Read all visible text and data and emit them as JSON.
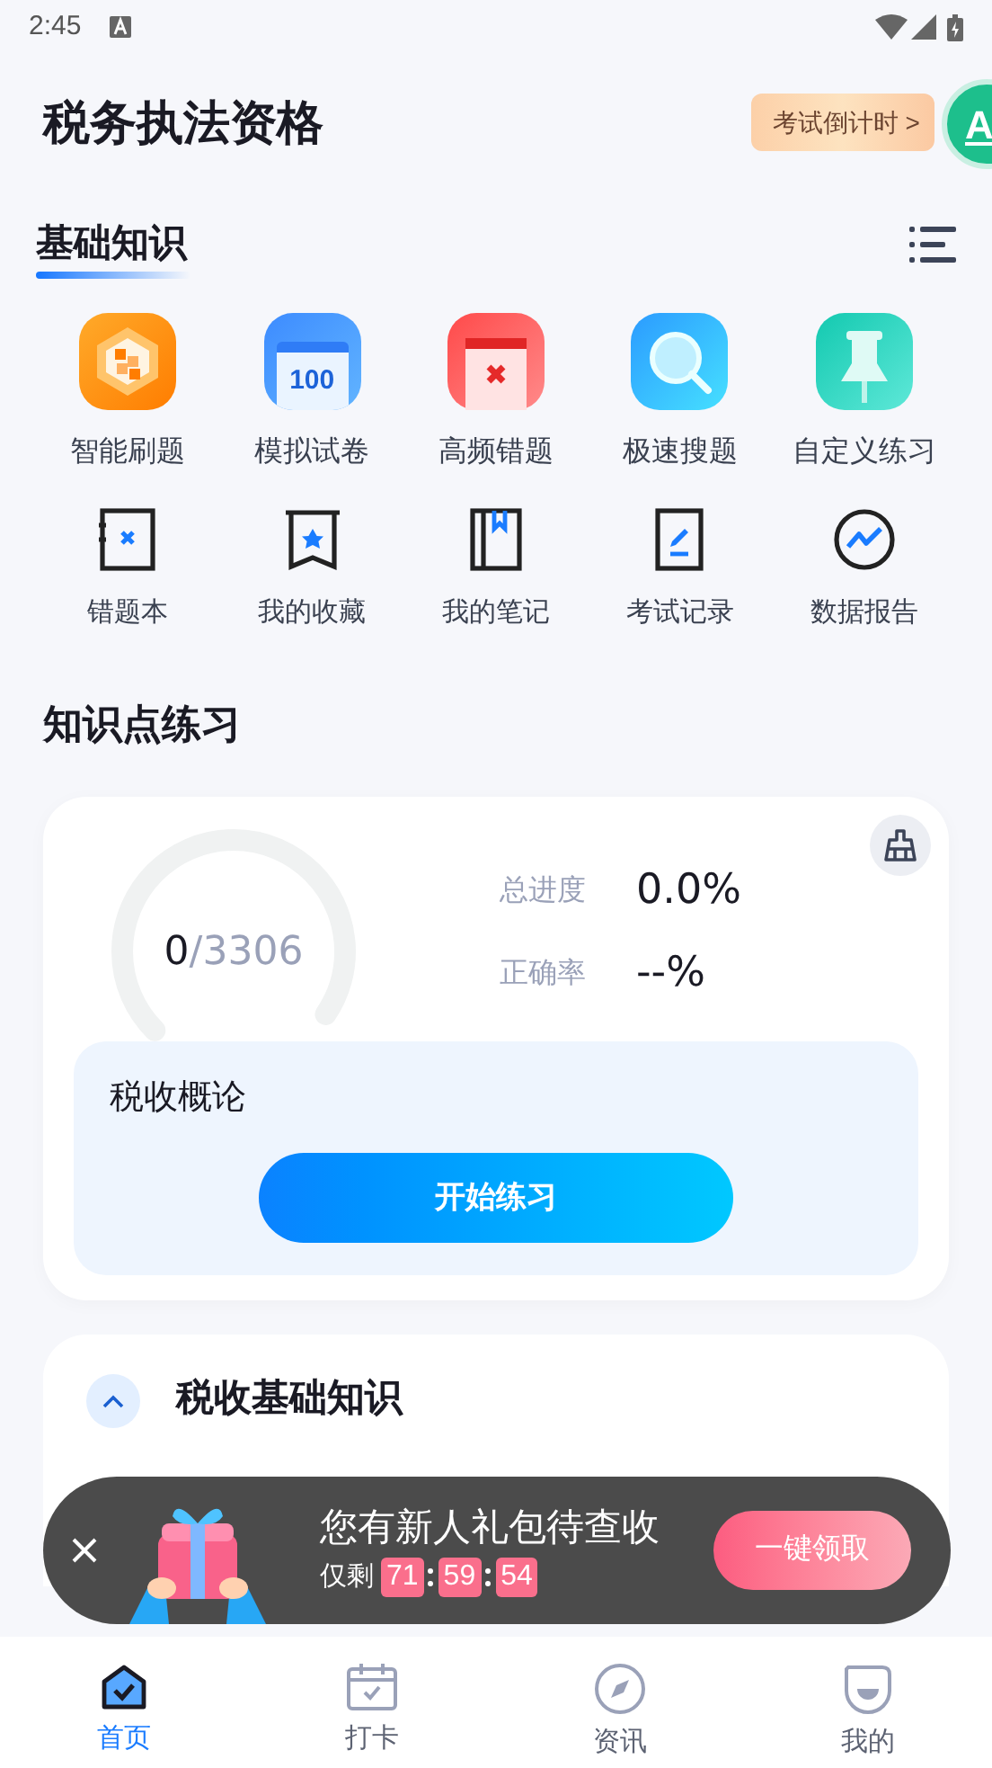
{
  "status_bar": {
    "time": "2:45"
  },
  "header": {
    "title": "税务执法资格",
    "countdown": "考试倒计时 >",
    "avatar": "A"
  },
  "section": {
    "title": "基础知识"
  },
  "features": [
    {
      "label": "智能刷题"
    },
    {
      "label": "模拟试卷",
      "icon_text": "100"
    },
    {
      "label": "高频错题"
    },
    {
      "label": "极速搜题"
    },
    {
      "label": "自定义练习"
    }
  ],
  "tools": [
    {
      "label": "错题本"
    },
    {
      "label": "我的收藏"
    },
    {
      "label": "我的笔记"
    },
    {
      "label": "考试记录"
    },
    {
      "label": "数据报告"
    }
  ],
  "practice": {
    "title": "知识点练习",
    "card": {
      "done": "0",
      "total": "/3306",
      "stats": [
        {
          "label": "总进度",
          "value": "0.0%"
        },
        {
          "label": "正确率",
          "value": "--%"
        }
      ],
      "chapter": "税收概论",
      "button": "开始练习"
    },
    "next_chapter": {
      "title": "税收基础知识",
      "expanded": true
    }
  },
  "promo": {
    "title": "您有新人礼包待查收",
    "prefix": "仅剩",
    "timer": [
      "71",
      "59",
      "54"
    ],
    "button": "一键领取"
  },
  "tabs": [
    {
      "label": "首页",
      "selected": true
    },
    {
      "label": "打卡",
      "selected": false
    },
    {
      "label": "资讯",
      "selected": false
    },
    {
      "label": "我的",
      "selected": false
    }
  ]
}
